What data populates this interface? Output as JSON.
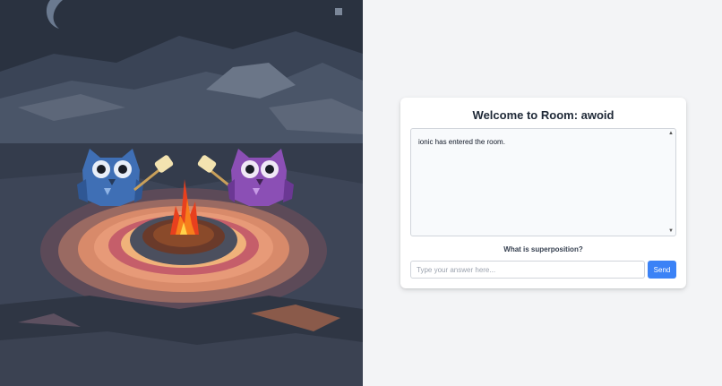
{
  "room": {
    "title": "Welcome to Room: awoid"
  },
  "chat": {
    "messages": [
      "ionic has entered the room."
    ],
    "scroll_up_icon": "triangle-up",
    "scroll_down_icon": "triangle-down"
  },
  "question": {
    "text": "What is superposition?"
  },
  "answer": {
    "placeholder": "Type your answer here...",
    "value": ""
  },
  "send": {
    "label": "Send"
  },
  "colors": {
    "accent": "#3b82f6",
    "background": "#f3f4f6",
    "card": "#ffffff"
  }
}
